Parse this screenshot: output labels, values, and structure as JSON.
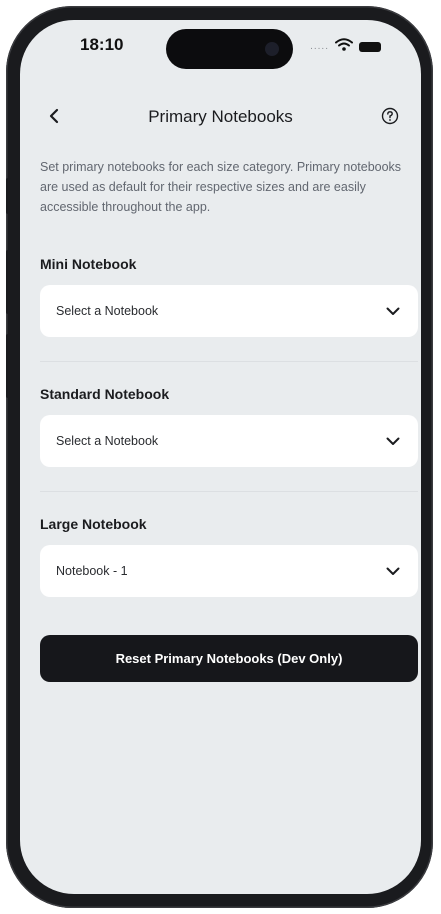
{
  "status_bar": {
    "time": "18:10",
    "signal_dots": "....."
  },
  "header": {
    "title": "Primary Notebooks",
    "back_icon": "chevron-left-icon",
    "help_icon": "question-circle-icon"
  },
  "description": "Set primary notebooks for each size category. Primary notebooks are used as default for their respective sizes and are easily accessible throughout the app.",
  "sections": [
    {
      "label": "Mini Notebook",
      "selected": "Select a Notebook"
    },
    {
      "label": "Standard Notebook",
      "selected": "Select a Notebook"
    },
    {
      "label": "Large Notebook",
      "selected": "Notebook - 1"
    }
  ],
  "reset_button": {
    "label": "Reset Primary Notebooks (Dev Only)"
  },
  "colors": {
    "screen_bg": "#e9ecee",
    "card_bg": "#ffffff",
    "button_bg": "#16171b",
    "text_primary": "#1b1c1f",
    "text_secondary": "#626770"
  }
}
